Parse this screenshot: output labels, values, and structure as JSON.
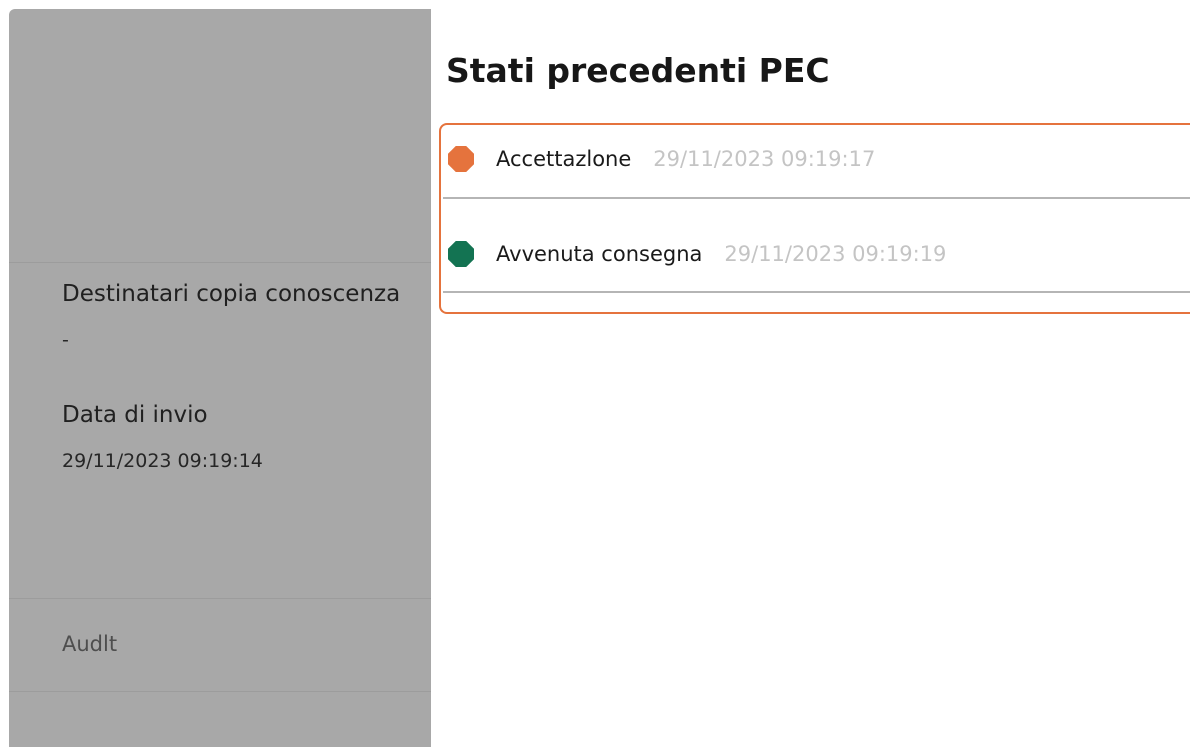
{
  "background": {
    "copy_recipients_label": "Destinatari copia conoscenza",
    "copy_recipients_value": "-",
    "send_date_label": "Data di invio",
    "send_date_value": "29/11/2023 09:19:14",
    "audit_link": "Audlt"
  },
  "drawer": {
    "title": "Stati precedenti PEC",
    "statuses": [
      {
        "label": "Accettazlone",
        "timestamp": "29/11/2023 09:19:17",
        "color": "#e5733d"
      },
      {
        "label": "Avvenuta consegna",
        "timestamp": "29/11/2023 09:19:19",
        "color": "#137352"
      }
    ]
  },
  "colors": {
    "highlight_border": "#e5733d",
    "overlay": "#a8a8a8"
  }
}
